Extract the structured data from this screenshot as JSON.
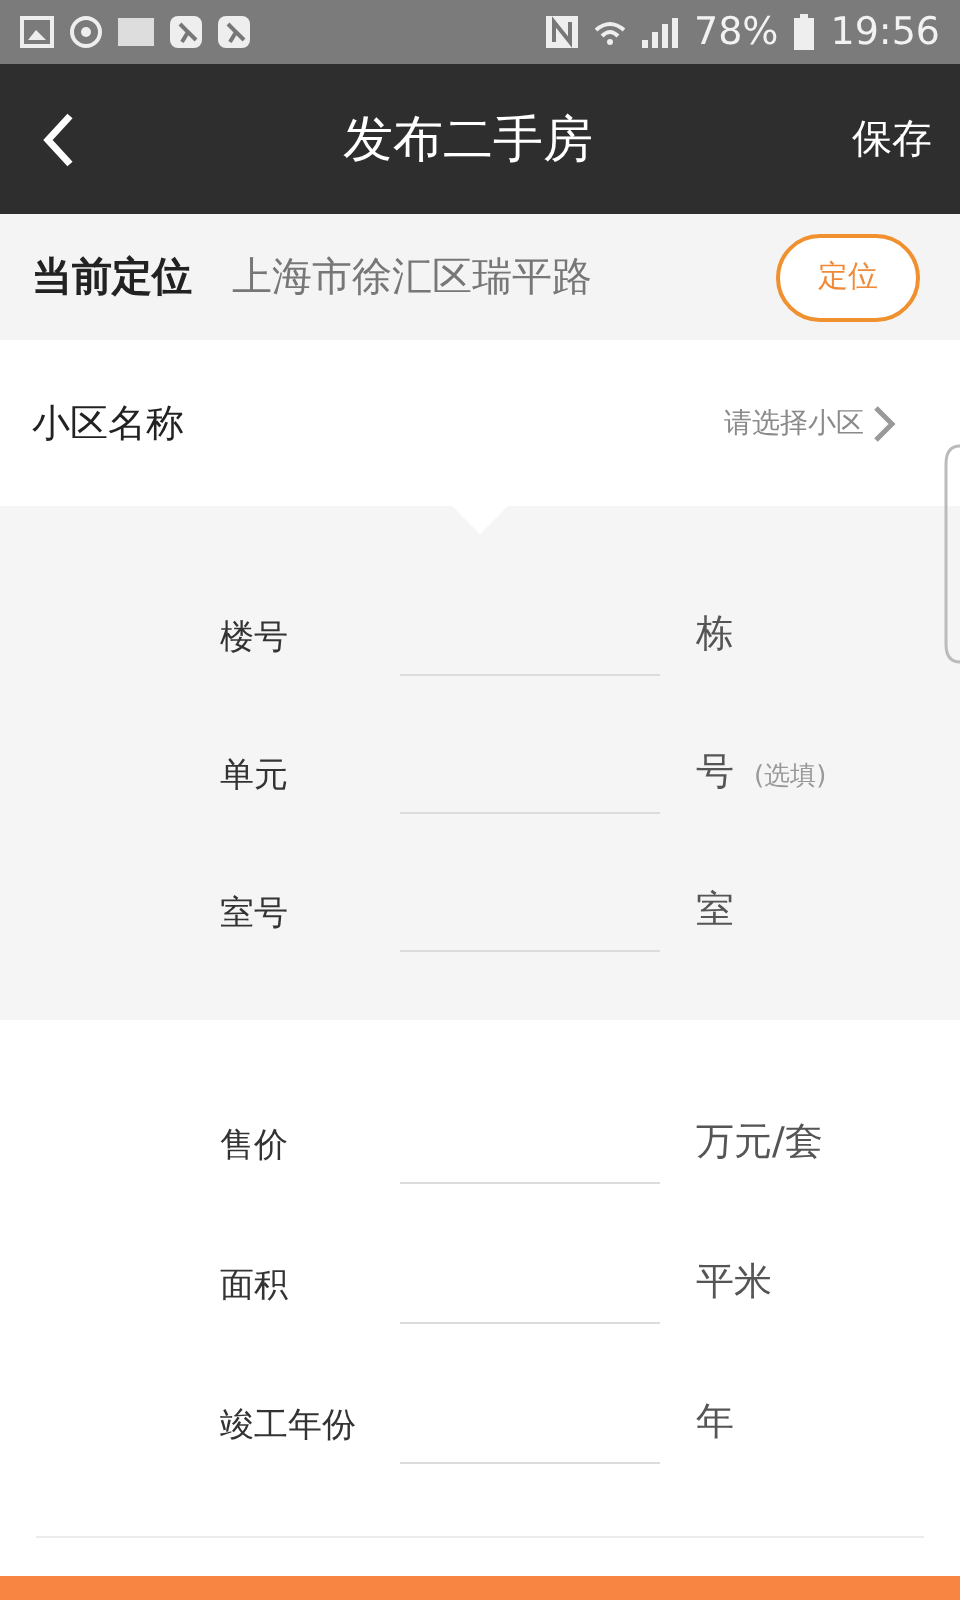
{
  "status_bar": {
    "battery": "78%",
    "time": "19:56"
  },
  "header": {
    "title": "发布二手房",
    "action": "保存"
  },
  "location": {
    "label": "当前定位",
    "address": "上海市徐汇区瑞平路",
    "button": "定位"
  },
  "community": {
    "label": "小区名称",
    "placeholder": "请选择小区"
  },
  "address_fields": [
    {
      "label": "楼号",
      "unit": "栋"
    },
    {
      "label": "单元",
      "unit": "号",
      "note": "(选填)"
    },
    {
      "label": "室号",
      "unit": "室"
    }
  ],
  "detail_fields": [
    {
      "label": "售价",
      "unit": "万元/套"
    },
    {
      "label": "面积",
      "unit": "平米"
    },
    {
      "label": "竣工年份",
      "unit": "年"
    }
  ]
}
